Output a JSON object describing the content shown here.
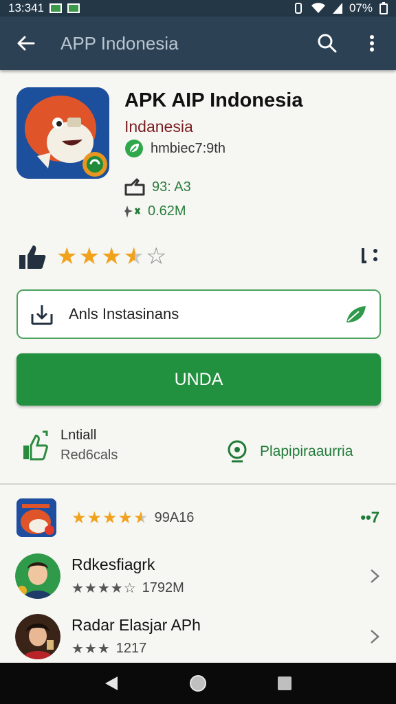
{
  "status_bar": {
    "time": "13:341",
    "battery": "07%"
  },
  "app_bar": {
    "title": "APP Indonesia"
  },
  "app": {
    "name": "APK AIP Indonesia",
    "developer": "Indanesia",
    "verified_text": "hmbiec7:9th",
    "downloads_text": "93: A3",
    "size_text": "0.62M"
  },
  "install_card": {
    "label": "Anls Instasinans"
  },
  "primary_button": {
    "label": "UNDA"
  },
  "info": {
    "left_line1": "Lntiall",
    "left_line2": "Red6cals",
    "right_label": "Plapipiraaurria"
  },
  "list": [
    {
      "rating_text": "99A16",
      "right_text": "••7"
    },
    {
      "title": "Rdkesfiagrk",
      "rating_text": "1792M"
    },
    {
      "title": "Radar Elasjar APh",
      "rating_text": "1217"
    }
  ],
  "colors": {
    "app_bar": "#2d4154",
    "status_bar": "#233747",
    "primary": "#22913f",
    "star": "#f0a21d",
    "developer": "#7a1e22"
  }
}
